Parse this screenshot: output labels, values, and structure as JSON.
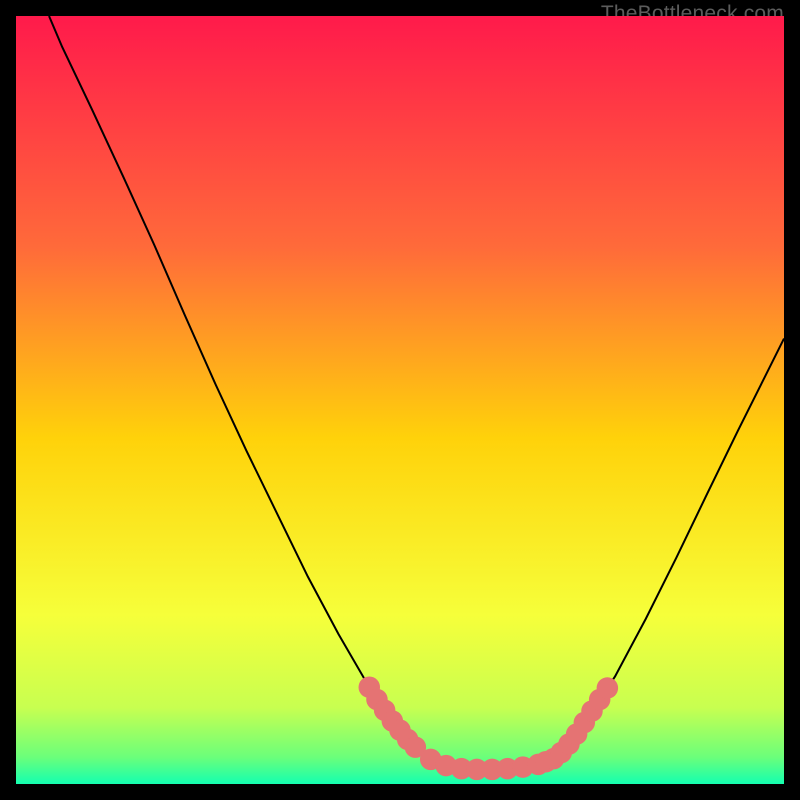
{
  "watermark": "TheBottleneck.com",
  "chart_data": {
    "type": "line",
    "title": "",
    "xlabel": "",
    "ylabel": "",
    "xlim": [
      0,
      100
    ],
    "ylim": [
      0,
      100
    ],
    "gradient_stops": [
      {
        "offset": 0.0,
        "color": "#ff1a4b"
      },
      {
        "offset": 0.3,
        "color": "#ff6a3a"
      },
      {
        "offset": 0.55,
        "color": "#ffd20a"
      },
      {
        "offset": 0.78,
        "color": "#f6ff3a"
      },
      {
        "offset": 0.9,
        "color": "#c8ff50"
      },
      {
        "offset": 0.965,
        "color": "#6bff7a"
      },
      {
        "offset": 1.0,
        "color": "#14ffb0"
      }
    ],
    "series": [
      {
        "name": "bottleneck-curve",
        "stroke": "#000000",
        "points": [
          {
            "x": 4.3,
            "y": 100.0
          },
          {
            "x": 6.0,
            "y": 96.0
          },
          {
            "x": 8.0,
            "y": 91.8
          },
          {
            "x": 10.0,
            "y": 87.6
          },
          {
            "x": 14.0,
            "y": 79.0
          },
          {
            "x": 18.0,
            "y": 70.2
          },
          {
            "x": 22.0,
            "y": 61.0
          },
          {
            "x": 26.0,
            "y": 52.0
          },
          {
            "x": 30.0,
            "y": 43.4
          },
          {
            "x": 34.0,
            "y": 35.2
          },
          {
            "x": 38.0,
            "y": 27.0
          },
          {
            "x": 42.0,
            "y": 19.5
          },
          {
            "x": 46.0,
            "y": 12.6
          },
          {
            "x": 48.0,
            "y": 9.6
          },
          {
            "x": 50.0,
            "y": 7.0
          },
          {
            "x": 52.0,
            "y": 4.8
          },
          {
            "x": 54.0,
            "y": 3.2
          },
          {
            "x": 56.0,
            "y": 2.4
          },
          {
            "x": 58.0,
            "y": 2.0
          },
          {
            "x": 60.0,
            "y": 1.9
          },
          {
            "x": 62.0,
            "y": 1.9
          },
          {
            "x": 64.0,
            "y": 2.0
          },
          {
            "x": 66.0,
            "y": 2.2
          },
          {
            "x": 68.0,
            "y": 2.6
          },
          {
            "x": 70.0,
            "y": 3.3
          },
          {
            "x": 72.0,
            "y": 5.2
          },
          {
            "x": 74.0,
            "y": 8.0
          },
          {
            "x": 78.0,
            "y": 14.0
          },
          {
            "x": 82.0,
            "y": 21.5
          },
          {
            "x": 86.0,
            "y": 29.5
          },
          {
            "x": 90.0,
            "y": 37.8
          },
          {
            "x": 94.0,
            "y": 46.0
          },
          {
            "x": 97.0,
            "y": 52.0
          },
          {
            "x": 100.0,
            "y": 58.0
          }
        ]
      }
    ],
    "markers": {
      "name": "bottleneck-markers",
      "fill": "#e57373",
      "radius": 1.4,
      "points": [
        {
          "x": 46.0,
          "y": 12.6
        },
        {
          "x": 47.0,
          "y": 11.0
        },
        {
          "x": 48.0,
          "y": 9.6
        },
        {
          "x": 49.0,
          "y": 8.2
        },
        {
          "x": 50.0,
          "y": 7.0
        },
        {
          "x": 51.0,
          "y": 5.8
        },
        {
          "x": 52.0,
          "y": 4.8
        },
        {
          "x": 54.0,
          "y": 3.2
        },
        {
          "x": 56.0,
          "y": 2.4
        },
        {
          "x": 58.0,
          "y": 2.0
        },
        {
          "x": 60.0,
          "y": 1.9
        },
        {
          "x": 62.0,
          "y": 1.9
        },
        {
          "x": 64.0,
          "y": 2.0
        },
        {
          "x": 66.0,
          "y": 2.2
        },
        {
          "x": 68.0,
          "y": 2.55
        },
        {
          "x": 69.0,
          "y": 2.9
        },
        {
          "x": 70.0,
          "y": 3.3
        },
        {
          "x": 71.0,
          "y": 4.1
        },
        {
          "x": 72.0,
          "y": 5.2
        },
        {
          "x": 73.0,
          "y": 6.5
        },
        {
          "x": 74.0,
          "y": 8.0
        },
        {
          "x": 75.0,
          "y": 9.5
        },
        {
          "x": 76.0,
          "y": 11.0
        },
        {
          "x": 77.0,
          "y": 12.5
        }
      ]
    }
  }
}
